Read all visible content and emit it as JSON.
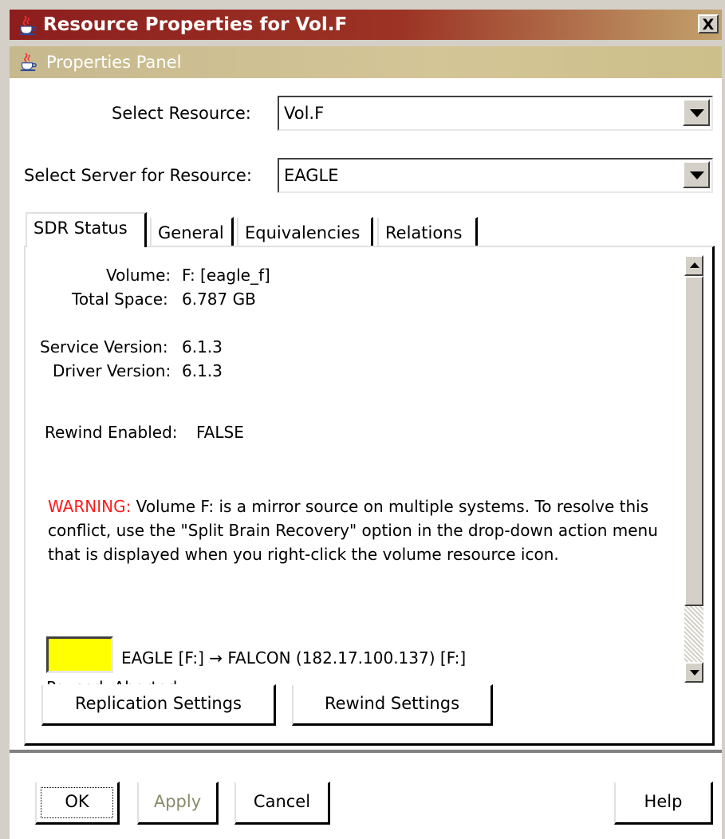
{
  "window": {
    "title": "Resource Properties for Vol.F",
    "close_label": "X",
    "app_icon": "java-coffee-cup-icon"
  },
  "panel": {
    "title": "Properties Panel"
  },
  "form": {
    "resource_label": "Select Resource:",
    "resource_value": "Vol.F",
    "server_label": "Select Server for Resource:",
    "server_value": "EAGLE"
  },
  "tabs": [
    {
      "label": "SDR Status",
      "active": true
    },
    {
      "label": "General",
      "active": false
    },
    {
      "label": "Equivalencies",
      "active": false
    },
    {
      "label": "Relations",
      "active": false
    }
  ],
  "status": {
    "volume_label": "Volume:",
    "volume_value": "F: [eagle_f]",
    "total_space_label": "Total Space:",
    "total_space_value": "6.787 GB",
    "service_version_label": "Service Version:",
    "service_version_value": "6.1.3",
    "driver_version_label": "Driver Version:",
    "driver_version_value": "6.1.3",
    "rewind_label": "Rewind Enabled:",
    "rewind_value": "FALSE",
    "warning_prefix": "WARNING:",
    "warning_text": " Volume F: is a mirror source on multiple systems. To resolve this conflict, use the \"Split Brain Recovery\" option in the drop-down action menu that is displayed when you right-click the volume resource icon.",
    "mirror_text": "EAGLE [F:] → FALCON (182.17.100.137) [F:]",
    "mirror_swatch_color": "#ffff00",
    "clipped_text": "Paused: Aborted"
  },
  "colors": {
    "warning": "#ff1a1a",
    "title_gradient_start": "#8c1e1e"
  },
  "actions": {
    "replication_label": "Replication Settings",
    "rewind_label": "Rewind Settings"
  },
  "footer": {
    "ok_label": "OK",
    "apply_label": "Apply",
    "cancel_label": "Cancel",
    "help_label": "Help"
  }
}
